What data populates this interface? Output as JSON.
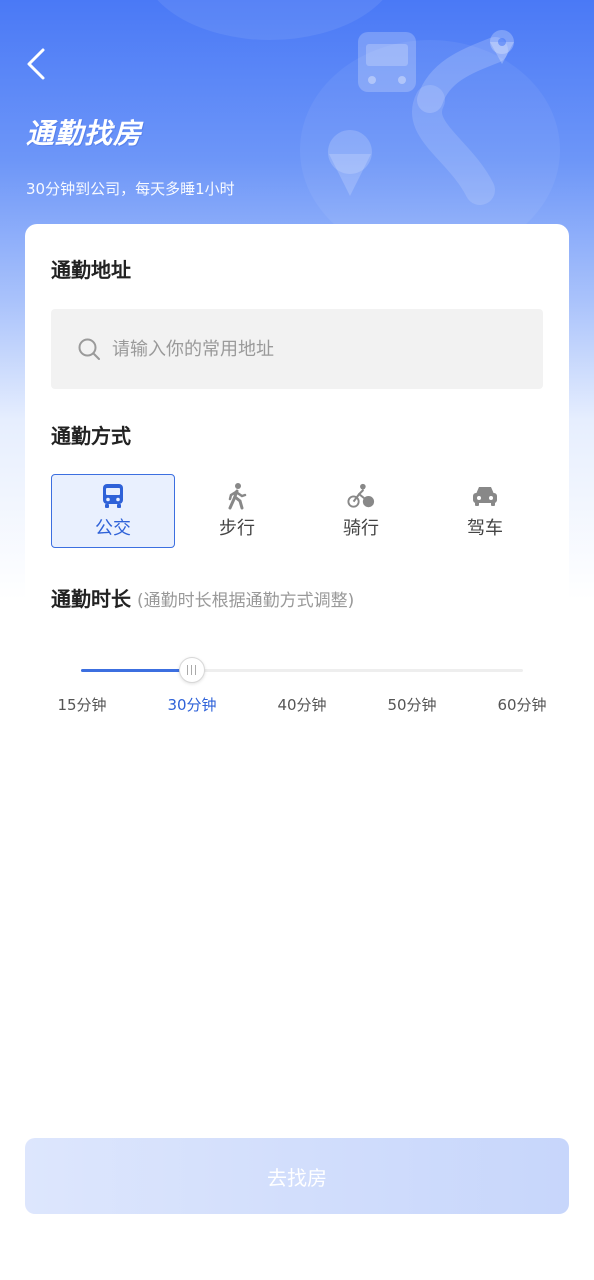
{
  "header": {
    "title": "通勤找房",
    "subtitle": "30分钟到公司，每天多睡1小时"
  },
  "address": {
    "title": "通勤地址",
    "placeholder": "请输入你的常用地址",
    "value": ""
  },
  "mode": {
    "title": "通勤方式",
    "selected": "公交",
    "items": [
      {
        "label": "公交",
        "icon": "bus-icon",
        "selected": true
      },
      {
        "label": "步行",
        "icon": "walk-icon",
        "selected": false
      },
      {
        "label": "骑行",
        "icon": "bike-icon",
        "selected": false
      },
      {
        "label": "驾车",
        "icon": "car-icon",
        "selected": false
      }
    ]
  },
  "duration": {
    "title": "通勤时长",
    "hint": "(通勤时长根据通勤方式调整)",
    "selected_index": 1,
    "ticks": [
      "15分钟",
      "30分钟",
      "40分钟",
      "50分钟",
      "60分钟"
    ]
  },
  "submit": {
    "label": "去找房"
  },
  "colors": {
    "accent": "#3c6fe0",
    "header_top": "#4a79f6",
    "selected_bg": "#e9f0fe",
    "button_disabled": "#c7d6fb"
  }
}
